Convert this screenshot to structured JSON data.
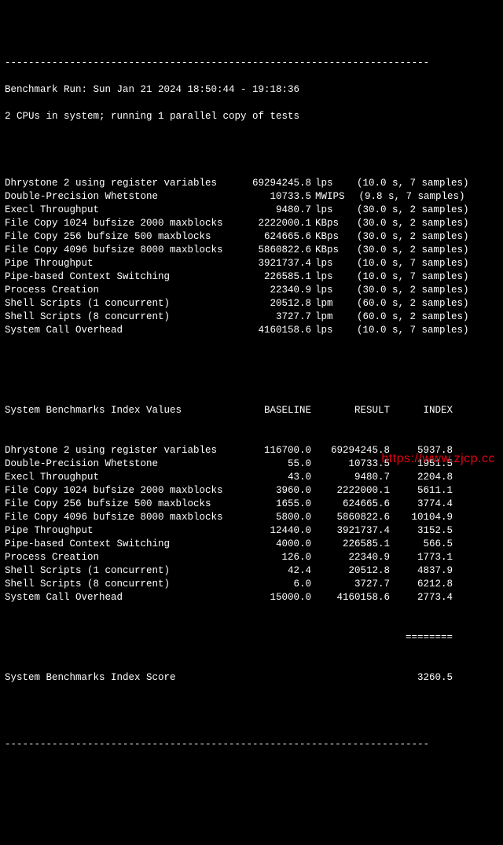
{
  "hr": "------------------------------------------------------------------------",
  "header": {
    "run_line": "Benchmark Run: Sun Jan 21 2024 18:50:44 - 19:18:36",
    "cpu_line": "2 CPUs in system; running 1 parallel copy of tests"
  },
  "tests": [
    {
      "name": "Dhrystone 2 using register variables",
      "value": "69294245.8",
      "unit": "lps",
      "timing": "(10.0 s, 7 samples)"
    },
    {
      "name": "Double-Precision Whetstone",
      "value": "10733.5",
      "unit": "MWIPS",
      "timing": "(9.8 s, 7 samples)"
    },
    {
      "name": "Execl Throughput",
      "value": "9480.7",
      "unit": "lps",
      "timing": "(30.0 s, 2 samples)"
    },
    {
      "name": "File Copy 1024 bufsize 2000 maxblocks",
      "value": "2222000.1",
      "unit": "KBps",
      "timing": "(30.0 s, 2 samples)"
    },
    {
      "name": "File Copy 256 bufsize 500 maxblocks",
      "value": "624665.6",
      "unit": "KBps",
      "timing": "(30.0 s, 2 samples)"
    },
    {
      "name": "File Copy 4096 bufsize 8000 maxblocks",
      "value": "5860822.6",
      "unit": "KBps",
      "timing": "(30.0 s, 2 samples)"
    },
    {
      "name": "Pipe Throughput",
      "value": "3921737.4",
      "unit": "lps",
      "timing": "(10.0 s, 7 samples)"
    },
    {
      "name": "Pipe-based Context Switching",
      "value": "226585.1",
      "unit": "lps",
      "timing": "(10.0 s, 7 samples)"
    },
    {
      "name": "Process Creation",
      "value": "22340.9",
      "unit": "lps",
      "timing": "(30.0 s, 2 samples)"
    },
    {
      "name": "Shell Scripts (1 concurrent)",
      "value": "20512.8",
      "unit": "lpm",
      "timing": "(60.0 s, 2 samples)"
    },
    {
      "name": "Shell Scripts (8 concurrent)",
      "value": "3727.7",
      "unit": "lpm",
      "timing": "(60.0 s, 2 samples)"
    },
    {
      "name": "System Call Overhead",
      "value": "4160158.6",
      "unit": "lps",
      "timing": "(10.0 s, 7 samples)"
    }
  ],
  "index_header": {
    "title": "System Benchmarks Index Values",
    "baseline": "BASELINE",
    "result": "RESULT",
    "index": "INDEX"
  },
  "index_rows": [
    {
      "name": "Dhrystone 2 using register variables",
      "baseline": "116700.0",
      "result": "69294245.8",
      "index": "5937.8"
    },
    {
      "name": "Double-Precision Whetstone",
      "baseline": "55.0",
      "result": "10733.5",
      "index": "1951.5"
    },
    {
      "name": "Execl Throughput",
      "baseline": "43.0",
      "result": "9480.7",
      "index": "2204.8"
    },
    {
      "name": "File Copy 1024 bufsize 2000 maxblocks",
      "baseline": "3960.0",
      "result": "2222000.1",
      "index": "5611.1"
    },
    {
      "name": "File Copy 256 bufsize 500 maxblocks",
      "baseline": "1655.0",
      "result": "624665.6",
      "index": "3774.4"
    },
    {
      "name": "File Copy 4096 bufsize 8000 maxblocks",
      "baseline": "5800.0",
      "result": "5860822.6",
      "index": "10104.9"
    },
    {
      "name": "Pipe Throughput",
      "baseline": "12440.0",
      "result": "3921737.4",
      "index": "3152.5"
    },
    {
      "name": "Pipe-based Context Switching",
      "baseline": "4000.0",
      "result": "226585.1",
      "index": "566.5"
    },
    {
      "name": "Process Creation",
      "baseline": "126.0",
      "result": "22340.9",
      "index": "1773.1"
    },
    {
      "name": "Shell Scripts (1 concurrent)",
      "baseline": "42.4",
      "result": "20512.8",
      "index": "4837.9"
    },
    {
      "name": "Shell Scripts (8 concurrent)",
      "baseline": "6.0",
      "result": "3727.7",
      "index": "6212.8"
    },
    {
      "name": "System Call Overhead",
      "baseline": "15000.0",
      "result": "4160158.6",
      "index": "2773.4"
    }
  ],
  "divider_equals": "========",
  "score": {
    "label": "System Benchmarks Index Score",
    "value": "3260.5"
  },
  "watermark": "https://www.zjcp.cc"
}
